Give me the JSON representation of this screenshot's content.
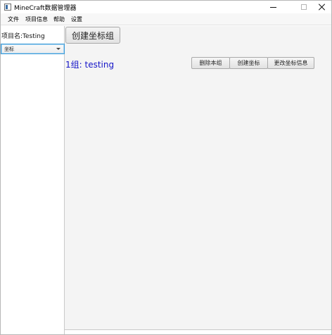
{
  "window": {
    "title": "MineCraft数据管理器",
    "controls": {
      "minimize": "minimize-icon",
      "maximize": "maximize-icon",
      "close": "close-icon"
    }
  },
  "menubar": {
    "items": [
      {
        "label": "文件"
      },
      {
        "label": "项目信息"
      },
      {
        "label": "帮助"
      },
      {
        "label": "设置"
      }
    ]
  },
  "sidebar": {
    "project_label": "项目名:Testing",
    "combo_value": "坐标"
  },
  "main": {
    "create_group_label": "创建坐标组",
    "group_title": "1组: testing",
    "buttons": {
      "delete_group": "删除本组",
      "create_coord": "创建坐标",
      "edit_coord": "更改坐标信息"
    }
  },
  "colors": {
    "group_title": "#1515c8",
    "focus_border": "#3c9bd6"
  }
}
